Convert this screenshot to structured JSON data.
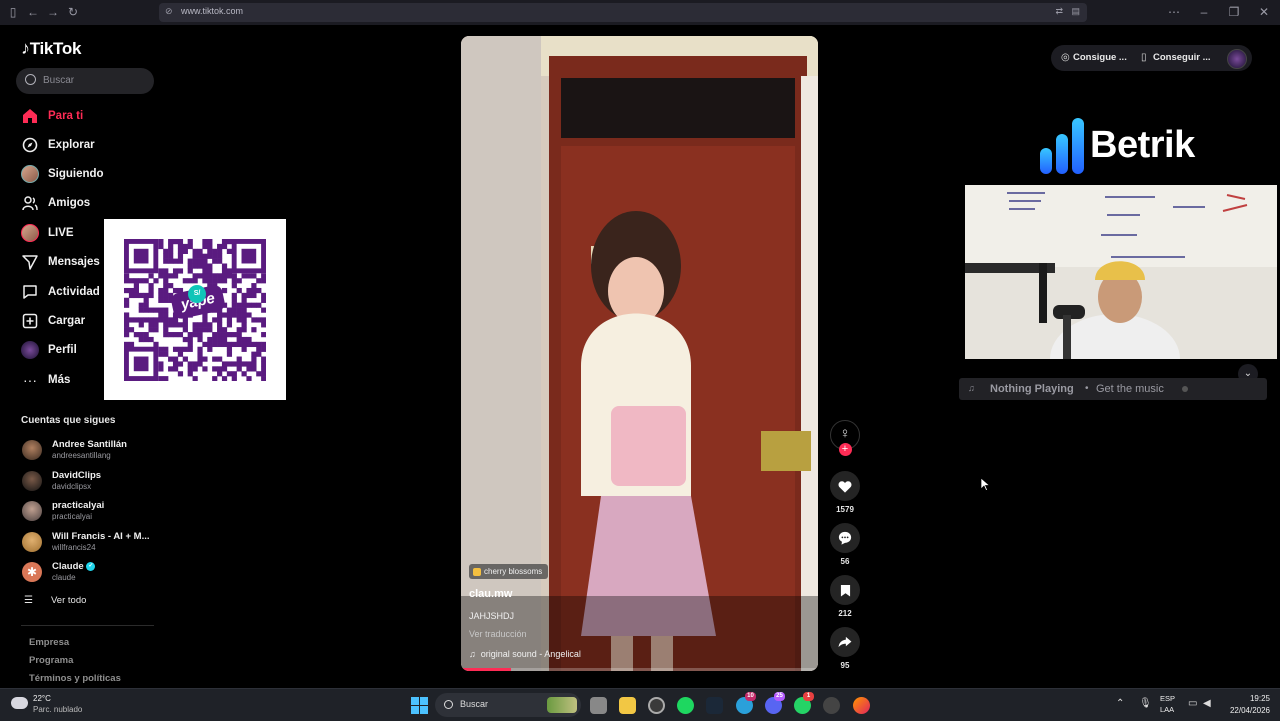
{
  "browser": {
    "url": "www.tiktok.com"
  },
  "sidebar": {
    "logo": "TikTok",
    "search_placeholder": "Buscar",
    "nav": [
      {
        "label": "Para ti"
      },
      {
        "label": "Explorar"
      },
      {
        "label": "Siguiendo"
      },
      {
        "label": "Amigos"
      },
      {
        "label": "LIVE"
      },
      {
        "label": "Mensajes"
      },
      {
        "label": "Actividad"
      },
      {
        "label": "Cargar"
      },
      {
        "label": "Perfil"
      },
      {
        "label": "Más"
      }
    ],
    "following_title": "Cuentas que sigues",
    "following": [
      {
        "name": "Andree Santillán",
        "handle": "andreesantillang"
      },
      {
        "name": "DavidClips",
        "handle": "davidclipsx"
      },
      {
        "name": "practicalyai",
        "handle": "practicalyai"
      },
      {
        "name": "Will Francis - AI + M...",
        "handle": "willfrancis24"
      },
      {
        "name": "Claude",
        "handle": "claude"
      }
    ],
    "see_all": "Ver todo",
    "footer": [
      "Empresa",
      "Programa",
      "Términos y políticas"
    ]
  },
  "qr": {
    "brand": "yape",
    "badge": "S/"
  },
  "video": {
    "effect_tag": "cherry blossoms",
    "author": "clau.mw",
    "caption": "JAHJSHDJ",
    "translate": "Ver traducción",
    "sound": "original sound - Angelical",
    "progress_percent": 14,
    "likes": "1579",
    "comments": "56",
    "saves": "212",
    "shares": "95"
  },
  "header_right": {
    "coins": "Consigue ...",
    "app": "Conseguir ..."
  },
  "overlay": {
    "brand": "Betrik",
    "player_status": "Nothing Playing",
    "player_sep": "•",
    "player_cta": "Get the music"
  },
  "taskbar": {
    "weather_temp": "22°C",
    "weather_desc": "Parc. nublado",
    "search": "Buscar",
    "lang1": "ESP",
    "lang2": "LAA",
    "time": "19:25",
    "date": "22/04/2026",
    "badges": [
      "10",
      "25",
      "1"
    ]
  },
  "colors": {
    "accent": "#fe2c55",
    "yape": "#5a1b80"
  }
}
